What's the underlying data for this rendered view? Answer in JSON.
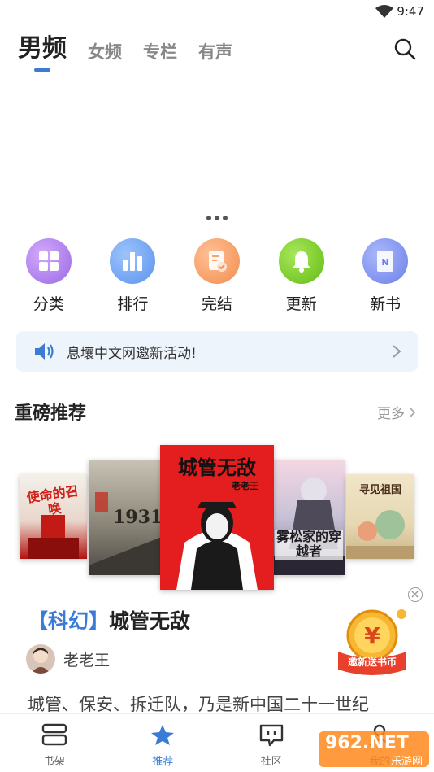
{
  "status": {
    "time": "9:47"
  },
  "top_tabs": [
    {
      "label": "男频",
      "active": true
    },
    {
      "label": "女频"
    },
    {
      "label": "专栏"
    },
    {
      "label": "有声"
    }
  ],
  "categories": [
    {
      "label": "分类",
      "icon": "grid-icon",
      "color": "#b985f0"
    },
    {
      "label": "排行",
      "icon": "bar-chart-icon",
      "color": "#6fa4f2"
    },
    {
      "label": "完结",
      "icon": "doc-check-icon",
      "color": "#f7a36c"
    },
    {
      "label": "更新",
      "icon": "bell-icon",
      "color": "#7ccf2c"
    },
    {
      "label": "新书",
      "icon": "book-icon",
      "color": "#7d92f0"
    }
  ],
  "notice": {
    "text": "息壤中文网邀新活动!"
  },
  "section": {
    "title": "重磅推荐",
    "more": "更多"
  },
  "books": [
    {
      "cover_title": "使命的召唤"
    },
    {
      "cover_title": "1931"
    },
    {
      "cover_title": "城管无敌",
      "cover_author": "老老王"
    },
    {
      "cover_title": "雾松家的穿越者"
    },
    {
      "cover_title": "寻见祖国"
    }
  ],
  "featured": {
    "tag": "【科幻】",
    "title": "城管无敌",
    "author": "老老王",
    "description": "城管、保安、拆迁队，乃是新中国二十一世纪"
  },
  "promo": {
    "label": "邀新送书币"
  },
  "nav": [
    {
      "label": "书架",
      "icon": "bookshelf-icon"
    },
    {
      "label": "推荐",
      "icon": "star-icon",
      "active": true
    },
    {
      "label": "社区",
      "icon": "chat-icon"
    },
    {
      "label": "我的",
      "icon": "user-icon"
    }
  ],
  "watermark": {
    "text": "962.NET",
    "sub": "乐游网"
  },
  "colors": {
    "accent": "#3a7bd5",
    "notice_bg": "#eef4fb"
  }
}
